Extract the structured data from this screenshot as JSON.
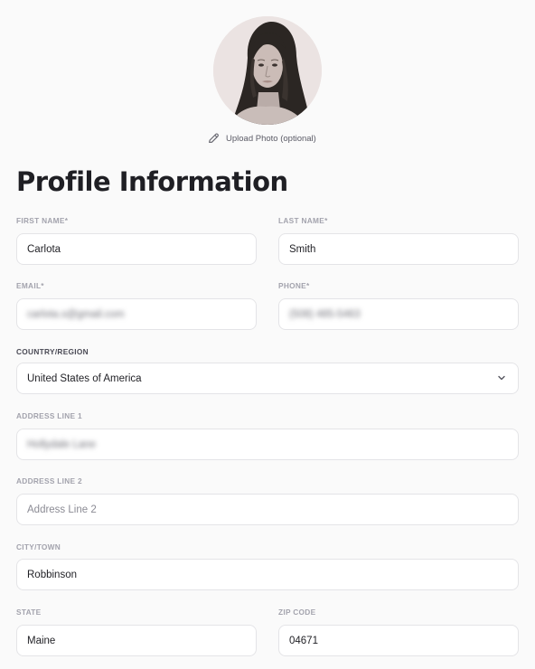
{
  "avatar": {
    "alt": "Profile photo"
  },
  "upload_label": "Upload Photo (optional)",
  "page_title": "Profile Information",
  "fields": {
    "first_name": {
      "label": "FIRST NAME*",
      "value": "Carlota"
    },
    "last_name": {
      "label": "LAST NAME*",
      "value": "Smith"
    },
    "email": {
      "label": "EMAIL*",
      "value": "carlota.s@gmail.com"
    },
    "phone": {
      "label": "PHONE*",
      "value": "(508) 485-5463"
    },
    "country": {
      "label": "COUNTRY/REGION",
      "value": "United States of America"
    },
    "address1": {
      "label": "ADDRESS LINE 1",
      "value": "Hollydale Lane"
    },
    "address2": {
      "label": "ADDRESS LINE 2",
      "placeholder": "Address Line 2"
    },
    "city": {
      "label": "CITY/TOWN",
      "value": "Robbinson"
    },
    "state": {
      "label": "STATE",
      "value": "Maine"
    },
    "zip": {
      "label": "ZIP CODE",
      "value": "04671"
    }
  },
  "colors": {
    "background": "#fafafa",
    "field_border": "#e4e4e7",
    "label": "#a3a3ad",
    "text": "#1f1f24"
  }
}
